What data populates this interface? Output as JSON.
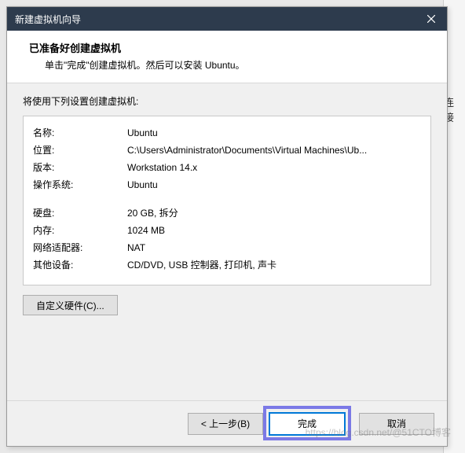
{
  "titlebar": {
    "title": "新建虚拟机向导"
  },
  "header": {
    "title": "已准备好创建虚拟机",
    "desc": "单击\"完成\"创建虚拟机。然后可以安装 Ubuntu。"
  },
  "body_label": "将使用下列设置创建虚拟机:",
  "settings": {
    "name_label": "名称:",
    "name_value": "Ubuntu",
    "location_label": "位置:",
    "location_value": "C:\\Users\\Administrator\\Documents\\Virtual Machines\\Ub...",
    "version_label": "版本:",
    "version_value": "Workstation 14.x",
    "os_label": "操作系统:",
    "os_value": "Ubuntu",
    "disk_label": "硬盘:",
    "disk_value": "20 GB, 拆分",
    "memory_label": "内存:",
    "memory_value": "1024 MB",
    "network_label": "网络适配器:",
    "network_value": "NAT",
    "other_label": "其他设备:",
    "other_value": "CD/DVD, USB 控制器, 打印机, 声卡"
  },
  "buttons": {
    "customize": "自定义硬件(C)...",
    "back": "< 上一步(B)",
    "finish": "完成",
    "cancel": "取消"
  },
  "side_text": "连接",
  "watermark": "https://blog.csdn.net/@51CTO博客"
}
